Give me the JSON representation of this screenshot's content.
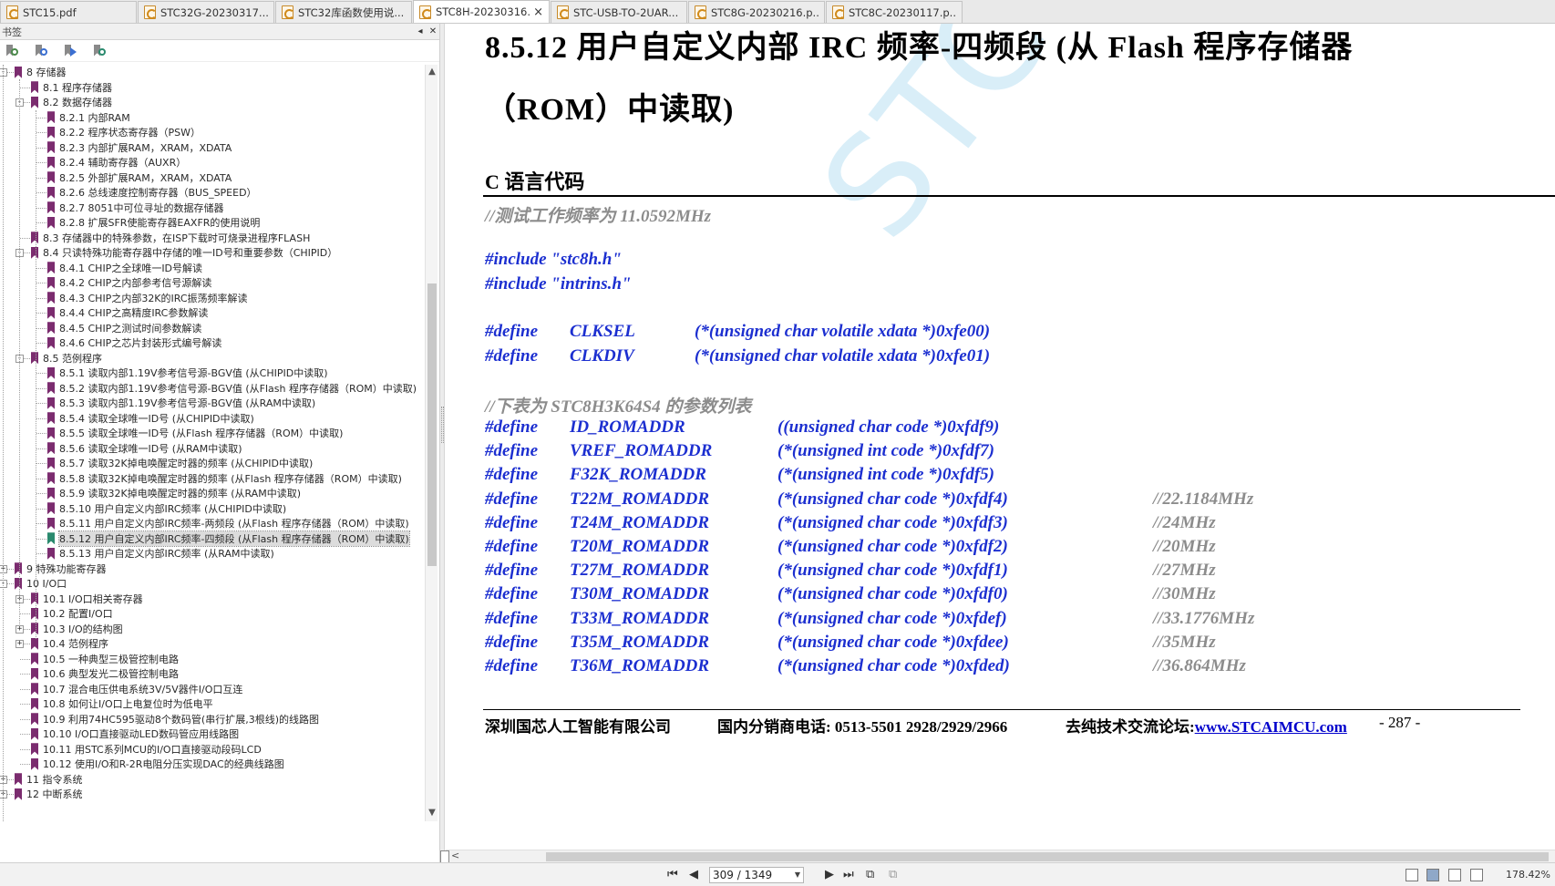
{
  "tabs": [
    {
      "label": "STC15.pdf",
      "active": false
    },
    {
      "label": "STC32G-20230317....",
      "active": false
    },
    {
      "label": "STC32库函数使用说...",
      "active": false
    },
    {
      "label": "STC8H-20230316.pd...",
      "active": true,
      "close": "×"
    },
    {
      "label": "STC-USB-TO-2UAR...",
      "active": false
    },
    {
      "label": "STC8G-20230216.p...",
      "active": false
    },
    {
      "label": "STC8C-20230117.p...",
      "active": false
    }
  ],
  "bookmarks": {
    "title": "书签",
    "collapse_label": "◂",
    "close_label": "✕",
    "items": [
      {
        "label": "8 存储器",
        "level": 0,
        "exp": "-"
      },
      {
        "label": "8.1 程序存储器",
        "level": 1,
        "exp": ""
      },
      {
        "label": "8.2 数据存储器",
        "level": 1,
        "exp": "-"
      },
      {
        "label": "8.2.1 内部RAM",
        "level": 2,
        "exp": ""
      },
      {
        "label": "8.2.2 程序状态寄存器（PSW）",
        "level": 2,
        "exp": ""
      },
      {
        "label": "8.2.3 内部扩展RAM，XRAM，XDATA",
        "level": 2,
        "exp": ""
      },
      {
        "label": "8.2.4 辅助寄存器（AUXR）",
        "level": 2,
        "exp": ""
      },
      {
        "label": "8.2.5 外部扩展RAM，XRAM，XDATA",
        "level": 2,
        "exp": ""
      },
      {
        "label": "8.2.6 总线速度控制寄存器（BUS_SPEED）",
        "level": 2,
        "exp": ""
      },
      {
        "label": "8.2.7 8051中可位寻址的数据存储器",
        "level": 2,
        "exp": ""
      },
      {
        "label": "8.2.8 扩展SFR使能寄存器EAXFR的使用说明",
        "level": 2,
        "exp": ""
      },
      {
        "label": "8.3 存储器中的特殊参数，在ISP下载时可烧录进程序FLASH",
        "level": 1,
        "exp": ""
      },
      {
        "label": "8.4 只读特殊功能寄存器中存储的唯一ID号和重要参数（CHIPID）",
        "level": 1,
        "exp": "-"
      },
      {
        "label": "8.4.1 CHIP之全球唯一ID号解读",
        "level": 2,
        "exp": ""
      },
      {
        "label": "8.4.2 CHIP之内部参考信号源解读",
        "level": 2,
        "exp": ""
      },
      {
        "label": "8.4.3 CHIP之内部32K的IRC振荡频率解读",
        "level": 2,
        "exp": ""
      },
      {
        "label": "8.4.4 CHIP之高精度IRC参数解读",
        "level": 2,
        "exp": ""
      },
      {
        "label": "8.4.5 CHIP之测试时间参数解读",
        "level": 2,
        "exp": ""
      },
      {
        "label": "8.4.6 CHIP之芯片封装形式编号解读",
        "level": 2,
        "exp": ""
      },
      {
        "label": "8.5 范例程序",
        "level": 1,
        "exp": "-"
      },
      {
        "label": "8.5.1 读取内部1.19V参考信号源-BGV值 (从CHIPID中读取)",
        "level": 2,
        "exp": ""
      },
      {
        "label": "8.5.2 读取内部1.19V参考信号源-BGV值 (从Flash 程序存储器（ROM）中读取)",
        "level": 2,
        "exp": ""
      },
      {
        "label": "8.5.3 读取内部1.19V参考信号源-BGV值 (从RAM中读取)",
        "level": 2,
        "exp": ""
      },
      {
        "label": "8.5.4 读取全球唯一ID号 (从CHIPID中读取)",
        "level": 2,
        "exp": ""
      },
      {
        "label": "8.5.5 读取全球唯一ID号 (从Flash 程序存储器（ROM）中读取)",
        "level": 2,
        "exp": ""
      },
      {
        "label": "8.5.6 读取全球唯一ID号 (从RAM中读取)",
        "level": 2,
        "exp": ""
      },
      {
        "label": "8.5.7 读取32K掉电唤醒定时器的频率 (从CHIPID中读取)",
        "level": 2,
        "exp": ""
      },
      {
        "label": "8.5.8 读取32K掉电唤醒定时器的频率 (从Flash 程序存储器（ROM）中读取)",
        "level": 2,
        "exp": ""
      },
      {
        "label": "8.5.9 读取32K掉电唤醒定时器的频率 (从RAM中读取)",
        "level": 2,
        "exp": ""
      },
      {
        "label": "8.5.10 用户自定义内部IRC频率 (从CHIPID中读取)",
        "level": 2,
        "exp": ""
      },
      {
        "label": "8.5.11 用户自定义内部IRC频率-两频段 (从Flash 程序存储器（ROM）中读取)",
        "level": 2,
        "exp": ""
      },
      {
        "label": "8.5.12 用户自定义内部IRC频率-四频段 (从Flash 程序存储器（ROM）中读取)",
        "level": 2,
        "exp": "",
        "selected": true
      },
      {
        "label": "8.5.13 用户自定义内部IRC频率 (从RAM中读取)",
        "level": 2,
        "exp": ""
      },
      {
        "label": "9 特殊功能寄存器",
        "level": 0,
        "exp": "+"
      },
      {
        "label": "10 I/O口",
        "level": 0,
        "exp": "-"
      },
      {
        "label": "10.1 I/O口相关寄存器",
        "level": 1,
        "exp": "+"
      },
      {
        "label": "10.2 配置I/O口",
        "level": 1,
        "exp": ""
      },
      {
        "label": "10.3 I/O的结构图",
        "level": 1,
        "exp": "+"
      },
      {
        "label": "10.4 范例程序",
        "level": 1,
        "exp": "+"
      },
      {
        "label": "10.5 一种典型三极管控制电路",
        "level": 1,
        "exp": ""
      },
      {
        "label": "10.6 典型发光二极管控制电路",
        "level": 1,
        "exp": ""
      },
      {
        "label": "10.7 混合电压供电系统3V/5V器件I/O口互连",
        "level": 1,
        "exp": ""
      },
      {
        "label": "10.8 如何让I/O口上电复位时为低电平",
        "level": 1,
        "exp": ""
      },
      {
        "label": "10.9 利用74HC595驱动8个数码管(串行扩展,3根线)的线路图",
        "level": 1,
        "exp": ""
      },
      {
        "label": "10.10 I/O口直接驱动LED数码管应用线路图",
        "level": 1,
        "exp": ""
      },
      {
        "label": "10.11 用STC系列MCU的I/O口直接驱动段码LCD",
        "level": 1,
        "exp": ""
      },
      {
        "label": "10.12 使用I/O和R-2R电阻分压实现DAC的经典线路图",
        "level": 1,
        "exp": ""
      },
      {
        "label": "11 指令系统",
        "level": 0,
        "exp": "+"
      },
      {
        "label": "12 中断系统",
        "level": 0,
        "exp": "+"
      }
    ]
  },
  "document": {
    "watermark": "STC",
    "heading_line1": "8.5.12  用户自定义内部  IRC  频率-四频段  (从  Flash  程序存储器",
    "heading_line2": "（ROM）中读取)",
    "section": "C 语言代码",
    "comment1": "//测试工作频率为 11.0592MHz",
    "includes": [
      "#include \"stc8h.h\"",
      "#include \"intrins.h\""
    ],
    "defines1": [
      {
        "kw": "#define",
        "name": "CLKSEL",
        "val": "(*(unsigned char volatile xdata *)0xfe00)"
      },
      {
        "kw": "#define",
        "name": "CLKDIV",
        "val": "(*(unsigned char volatile xdata *)0xfe01)"
      }
    ],
    "comment2": "//下表为 STC8H3K64S4 的参数列表",
    "defines2": [
      {
        "kw": "#define",
        "name": "ID_ROMADDR",
        "val": "((unsigned char code *)0xfdf9)",
        "cmt": ""
      },
      {
        "kw": "#define",
        "name": "VREF_ROMADDR",
        "val": "(*(unsigned int code *)0xfdf7)",
        "cmt": ""
      },
      {
        "kw": "#define",
        "name": "F32K_ROMADDR",
        "val": "(*(unsigned int code *)0xfdf5)",
        "cmt": ""
      },
      {
        "kw": "#define",
        "name": "T22M_ROMADDR",
        "val": "(*(unsigned char code *)0xfdf4)",
        "cmt": "//22.1184MHz"
      },
      {
        "kw": "#define",
        "name": "T24M_ROMADDR",
        "val": "(*(unsigned char code *)0xfdf3)",
        "cmt": "//24MHz"
      },
      {
        "kw": "#define",
        "name": "T20M_ROMADDR",
        "val": "(*(unsigned char code *)0xfdf2)",
        "cmt": "//20MHz"
      },
      {
        "kw": "#define",
        "name": "T27M_ROMADDR",
        "val": "(*(unsigned char code *)0xfdf1)",
        "cmt": "//27MHz"
      },
      {
        "kw": "#define",
        "name": "T30M_ROMADDR",
        "val": "(*(unsigned char code *)0xfdf0)",
        "cmt": "//30MHz"
      },
      {
        "kw": "#define",
        "name": "T33M_ROMADDR",
        "val": "(*(unsigned char code *)0xfdef)",
        "cmt": "//33.1776MHz"
      },
      {
        "kw": "#define",
        "name": "T35M_ROMADDR",
        "val": "(*(unsigned char code *)0xfdee)",
        "cmt": "//35MHz"
      },
      {
        "kw": "#define",
        "name": "T36M_ROMADDR",
        "val": "(*(unsigned char code *)0xfded)",
        "cmt": "//36.864MHz"
      }
    ],
    "footer_company": "深圳国芯人工智能有限公司",
    "footer_phone": "国内分销商电话: 0513-5501 2928/2929/2966",
    "footer_forum": "去纯技术交流论坛:",
    "footer_link": "www.STCAIMCU.com",
    "footer_page": "- 287 -"
  },
  "status": {
    "page": "309 / 1349",
    "zoom": "178.42%"
  },
  "colors": {
    "code": "#1c2fd0",
    "comment": "#8c8c8c",
    "bookmark": "#7b2c6f",
    "bookmark_selected": "#2a8a6e"
  }
}
